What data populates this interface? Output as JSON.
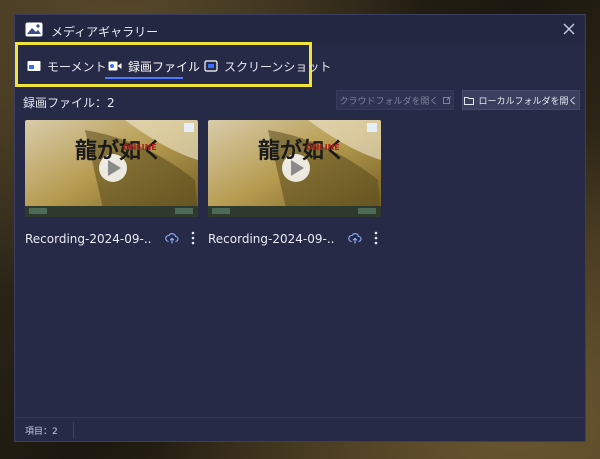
{
  "window": {
    "title": "メディアギャラリー"
  },
  "tabs": [
    {
      "label": "モーメント",
      "icon": "moment-icon"
    },
    {
      "label": "録画ファイル",
      "icon": "video-icon",
      "active": true
    },
    {
      "label": "スクリーンショット",
      "icon": "screenshot-icon"
    }
  ],
  "toolbar": {
    "count_label": "録画ファイル：2",
    "cloud_button": "クラウドフォルダを開く",
    "local_button": "ローカルフォルダを開く"
  },
  "files": [
    {
      "name": "Recording-2024-09-..."
    },
    {
      "name": "Recording-2024-09-..."
    }
  ],
  "thumbnail": {
    "title_text": "龍が如く",
    "subtitle_text": "ONLINE"
  },
  "status": {
    "items_label": "項目：2"
  },
  "colors": {
    "window_bg": "#262a47",
    "accent": "#4d7bff",
    "highlight": "#f0e43a"
  }
}
